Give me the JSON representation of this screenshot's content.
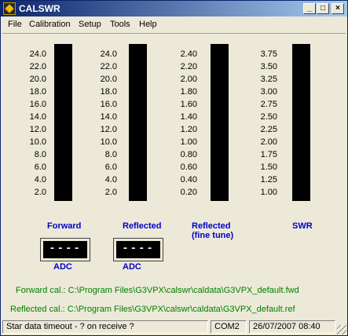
{
  "window": {
    "title": "CALSWR",
    "minimize": "_",
    "maximize": "□",
    "close": "×"
  },
  "menu": [
    "File",
    "Calibration",
    "Setup",
    "Tools",
    "Help"
  ],
  "meters": {
    "forward": {
      "label": "Forward",
      "scale": [
        "24.0",
        "22.0",
        "20.0",
        "18.0",
        "16.0",
        "14.0",
        "12.0",
        "10.0",
        "8.0",
        "6.0",
        "4.0",
        "2.0"
      ]
    },
    "reflected": {
      "label": "Reflected",
      "scale": [
        "24.0",
        "22.0",
        "20.0",
        "18.0",
        "16.0",
        "14.0",
        "12.0",
        "10.0",
        "8.0",
        "6.0",
        "4.0",
        "2.0"
      ]
    },
    "reflected_fine": {
      "label_line1": "Reflected",
      "label_line2": "(fine tune)",
      "scale": [
        "2.40",
        "2.20",
        "2.00",
        "1.80",
        "1.60",
        "1.40",
        "1.20",
        "1.00",
        "0.80",
        "0.60",
        "0.40",
        "0.20"
      ]
    },
    "swr": {
      "label": "SWR",
      "scale": [
        "3.75",
        "3.50",
        "3.25",
        "3.00",
        "2.75",
        "2.50",
        "2.25",
        "2.00",
        "1.75",
        "1.50",
        "1.25",
        "1.00"
      ]
    }
  },
  "adc": [
    {
      "display": "----",
      "label": "ADC"
    },
    {
      "display": "----",
      "label": "ADC"
    }
  ],
  "calibration": {
    "forward": "Forward cal.: C:\\Program Files\\G3VPX\\calswr\\caldata\\G3VPX_default.fwd",
    "reflected": "Reflected cal.: C:\\Program Files\\G3VPX\\calswr\\caldata\\G3VPX_default.ref"
  },
  "status": {
    "message": "Star data timeout - ? on receive ?",
    "port": "COM2",
    "datetime": "26/07/2007 08:40"
  },
  "colors": {
    "label_blue": "#0000cc",
    "cal_green": "#008000",
    "bar": "#000000"
  }
}
